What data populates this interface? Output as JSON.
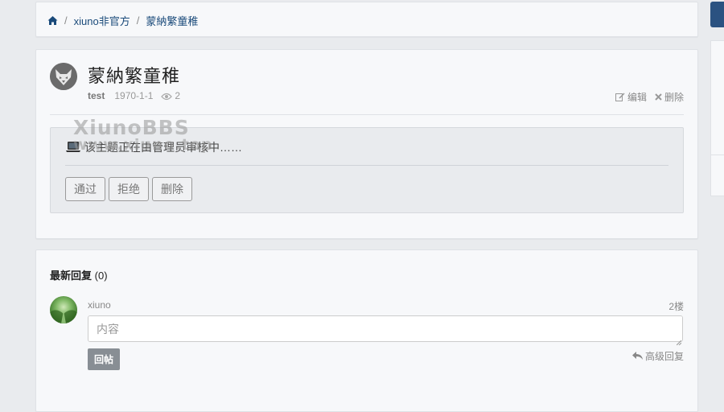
{
  "breadcrumb": {
    "home_icon": "home-icon",
    "items": [
      "xiuno非官方",
      "蒙納繁童稚"
    ]
  },
  "thread": {
    "title": "蒙納繁童稚",
    "author": "test",
    "date": "1970-1-1",
    "views": "2",
    "edit_label": "编辑",
    "delete_label": "删除",
    "review_message": "该主题正在由管理员审核中……",
    "approve_label": "通过",
    "reject_label": "拒绝",
    "remove_label": "删除"
  },
  "watermark": {
    "line1": "XiunoBBS",
    "line2": "www.xiuno.top"
  },
  "replies": {
    "title": "最新回复",
    "count": "(0)",
    "user": "xiuno",
    "floor": "2楼",
    "input_placeholder": "内容",
    "submit_label": "回帖",
    "advanced_label": "高级回复"
  },
  "colors": {
    "page_bg": "#e9ebee",
    "card_bg": "#f7f8fa",
    "link": "#1a4a7a",
    "accent": "#2b5281",
    "submit_bg": "#888e94"
  }
}
